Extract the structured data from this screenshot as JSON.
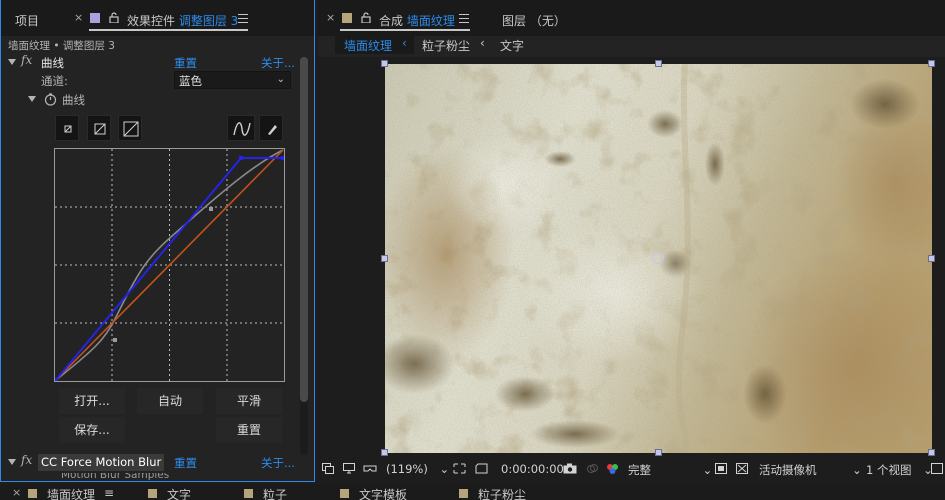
{
  "left_panel": {
    "tab_project": "项目",
    "tab_effects_prefix": "效果控件",
    "tab_effects_layer": "调整图层 3",
    "subtitle": "墙面纹理 • 调整图层 3",
    "effect_curves": {
      "name": "曲线",
      "reset": "重置",
      "about": "关于...",
      "channel_label": "通道:",
      "channel_value": "蓝色",
      "curves_prop": "曲线",
      "buttons": {
        "open": "打开...",
        "auto": "自动",
        "smooth": "平滑",
        "save": "保存...",
        "reset": "重置"
      }
    },
    "effect_cc": {
      "name": "CC Force Motion Blur",
      "reset": "重置",
      "about": "关于..."
    },
    "cut_row": "Motion Blur Samples"
  },
  "right_panel": {
    "tab_comp_prefix": "合成",
    "tab_comp_name": "墙面纹理",
    "tab_layer": "图层 （无）",
    "breadcrumbs": [
      "墙面纹理",
      "粒子粉尘",
      "文字"
    ],
    "viewer": {
      "zoom": "(119%)",
      "timecode": "0:00:00:00",
      "resolution": "完整",
      "camera": "活动摄像机",
      "views": "1 个视图"
    }
  },
  "bottom_tabs": [
    "墙面纹理",
    "文字",
    "粒子",
    "文字模板",
    "粒子粉尘"
  ],
  "colors": {
    "accent_blue": "#2d8ceb",
    "curve_blue": "#2424e6",
    "curve_orange": "#c4521c",
    "curve_gray": "#8a8a8a",
    "tab_swatch_purple": "#a8a3e0",
    "tab_swatch_tan": "#b6a47c"
  }
}
